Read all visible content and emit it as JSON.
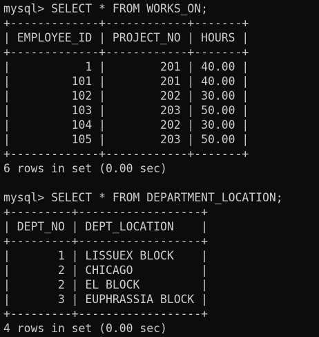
{
  "terminal": {
    "lines": [
      "mysql> SELECT * FROM WORKS_ON;",
      "+-------------+------------+-------+",
      "| EMPLOYEE_ID | PROJECT_NO | HOURS |",
      "+-------------+------------+-------+",
      "|           1 |        201 | 40.00 |",
      "|         101 |        201 | 40.00 |",
      "|         102 |        202 | 30.00 |",
      "|         103 |        203 | 50.00 |",
      "|         104 |        202 | 30.00 |",
      "|         105 |        203 | 50.00 |",
      "+-------------+------------+-------+",
      "6 rows in set (0.00 sec)",
      "",
      "mysql> SELECT * FROM DEPARTMENT_LOCATION;",
      "+---------+------------------+",
      "| DEPT_NO | DEPT_LOCATION    |",
      "+---------+------------------+",
      "|       1 | LISSUEX BLOCK    |",
      "|       2 | CHICAGO          |",
      "|       2 | EL BLOCK         |",
      "|       3 | EUPHRASSIA BLOCK |",
      "+---------+------------------+",
      "4 rows in set (0.00 sec)"
    ]
  }
}
